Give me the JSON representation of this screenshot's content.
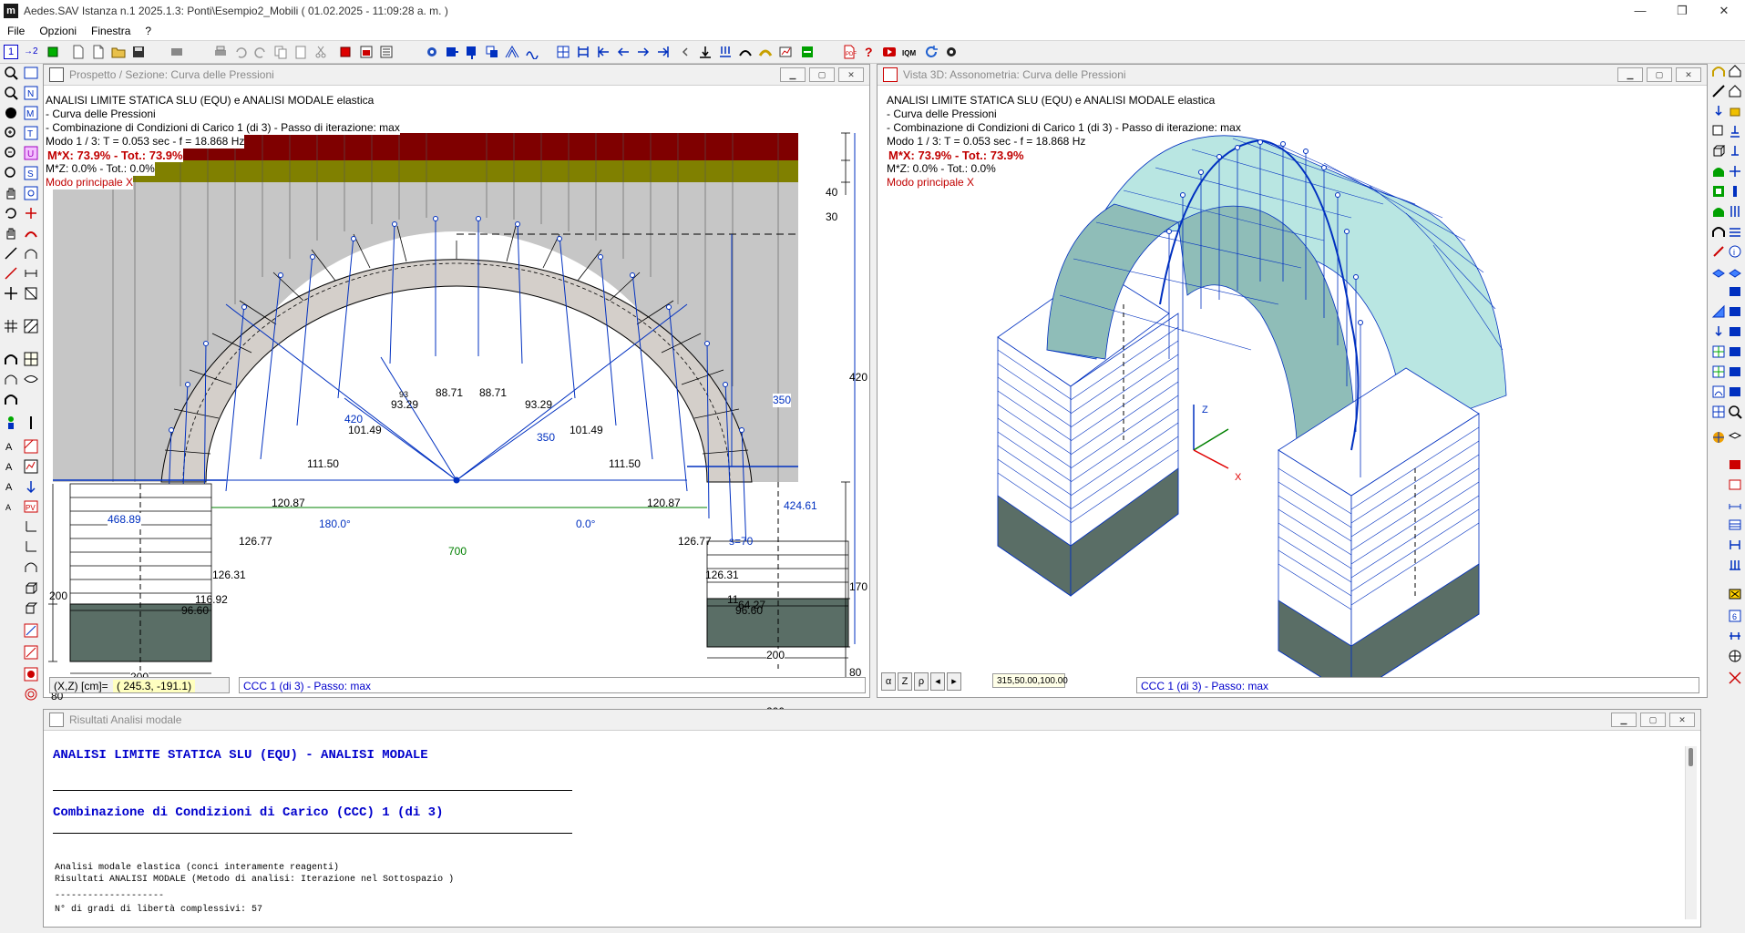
{
  "window": {
    "app_icon": "aedes-logo-icon",
    "title": "Aedes.SAV Istanza n.1 2025.1.3: Ponti\\Esempio2_Mobili  ( 01.02.2025 - 11:09:28 a. m. )",
    "minimize_label": "—",
    "restore_label": "❐",
    "close_label": "✕"
  },
  "menu": {
    "items": [
      "File",
      "Opzioni",
      "Finestra",
      "?"
    ]
  },
  "toolbar": {
    "text_1": "1",
    "text_2": "→2"
  },
  "left_panel": {
    "title": "Prospetto / Sezione: Curva delle Pressioni",
    "lines": [
      "ANALISI LIMITE STATICA SLU (EQU) e ANALISI MODALE elastica",
      "- Curva delle Pressioni",
      "- Combinazione di Condizioni di Carico 1 (di 3) - Passo di iterazione: max",
      "Modo 1 / 3: T = 0.053 sec - f = 18.868 Hz",
      "M*X: 73.9% - Tot.: 73.9%",
      "M*Z: 0.0% - Tot.: 0.0%",
      "Modo principale X"
    ],
    "coord_label": "(X,Z) [cm]=",
    "coord_value": "( 245.3, -191.1)",
    "status": "CCC 1 (di 3) - Passo: max",
    "labels": {
      "l40": "40",
      "l30": "30",
      "l420": "420",
      "l170": "170",
      "l80r": "80",
      "l200l": "200",
      "l80l": "80",
      "l200a": "200",
      "l200b": "200",
      "l200c": "200",
      "l200d": "200",
      "f468": "468.89",
      "f424": "424.61",
      "ang180": "180.0°",
      "ang0": "0.0°",
      "span700": "700",
      "r350a": "350",
      "r350b": "350",
      "r420": "420",
      "s70": "s=70",
      "v8871a": "88.71",
      "v8871b": "88.71",
      "v9329a": "93.29",
      "v9329b": "93.29",
      "v10149a": "101.49",
      "v10149b": "101.49",
      "v11150a": "111.50",
      "v11150b": "111.50",
      "v12087a": "120.87",
      "v12087b": "120.87",
      "v12677a": "126.77",
      "v12677b": "126.77",
      "v12631a": "126.31",
      "v12631b": "126.31",
      "v11692": "116.92",
      "v11x": "11",
      "v9660a": "96.60",
      "v9660b": "96.60",
      "v6427": "64.27",
      "v93x": "93"
    }
  },
  "right_panel": {
    "title": "Vista 3D: Assonometria: Curva delle Pressioni",
    "lines": [
      "ANALISI LIMITE STATICA SLU (EQU) e ANALISI MODALE elastica",
      "- Curva delle Pressioni",
      "- Combinazione di Condizioni di Carico 1 (di 3) - Passo di iterazione: max",
      "Modo 1 / 3: T = 0.053 sec - f = 18.868 Hz",
      "M*X: 73.9% - Tot.: 73.9%",
      "M*Z: 0.0% - Tot.: 0.0%",
      "Modo principale X"
    ],
    "axis_z": "Z",
    "axis_x": "X",
    "nav_alpha": "α",
    "nav_z": "Z",
    "nav_rho": "ρ",
    "nav_left": "◂",
    "nav_right": "▸",
    "view_params": "315,50.00,100.00",
    "status": "CCC 1 (di 3) - Passo: max"
  },
  "results_panel": {
    "title": "Risultati Analisi modale",
    "heading1": "ANALISI LIMITE STATICA SLU (EQU) - ANALISI MODALE",
    "heading2": "Combinazione di Condizioni di Carico (CCC) 1 (di 3)",
    "line1": "Analisi modale elastica (conci interamente reagenti)",
    "line2": "Risultati ANALISI MODALE (Metodo di analisi: Iterazione nel Sottospazio )",
    "line3": "--------------------",
    "line4": "N° di gradi di libertà complessivi:  57"
  },
  "colors": {
    "accent_blue": "#0000cc",
    "arch_fill": "#d4cfca",
    "infill_gray": "#c6c6c6",
    "dark_red_band": "#7f0000",
    "olive_band": "#808000",
    "foundation": "#5a6e66",
    "arch_3d": "#b9e6e2"
  }
}
